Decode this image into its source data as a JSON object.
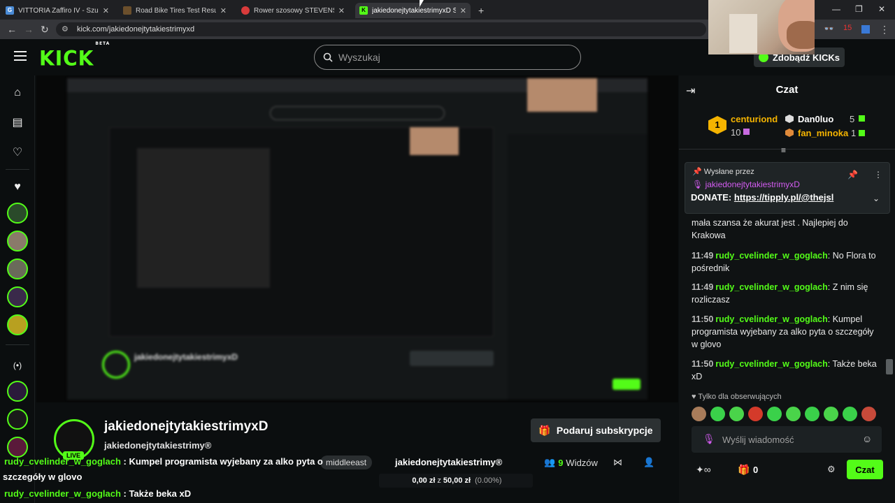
{
  "browser": {
    "tabs": [
      {
        "title": "VITTORIA Zaffiro IV - Szukaj w G",
        "color": "#4a8bd6"
      },
      {
        "title": "Road Bike Tires Test Results | Bi",
        "color": "#6b4f2c"
      },
      {
        "title": "Rower szosowy STEVENS Izoard",
        "color": "#d93b3b"
      },
      {
        "title": "jakiedonejtytakiestrimyxD Stre",
        "color": "#53fc18"
      }
    ],
    "url": "kick.com/jakiedonejtytakiestrimyxd",
    "ext_badge": "15"
  },
  "header": {
    "logo": "KICK",
    "logo_sup": "BETA",
    "search_placeholder": "Wyszukaj",
    "kicks_label": "Zdobądź KICKs"
  },
  "channel": {
    "name": "jakiedonejtytakiestrimyxD",
    "subtitle": "jakiedonejtytakiestrimy®",
    "live": "LIVE",
    "gift_label": "Podaruj subskrypcje",
    "tag": "middleeast",
    "viewers_count": "9",
    "viewers_label": "Widzów",
    "goal_name": "jakiedonejtytakiestrimy®",
    "goal_current": "0,00 zł",
    "goal_sep": "z",
    "goal_target": "50,00 zł",
    "goal_pct": "(0.00%)"
  },
  "overlay": {
    "line1_user": "rudy_cvelinder_w_goglach",
    "line1_text": " : Kumpel programista wyjebany za alko pyta o",
    "line2_text": "szczegóły w glovo",
    "line3_user": "rudy_cvelinder_w_goglach",
    "line3_text": " : Także beka xD"
  },
  "chat": {
    "title": "Czat",
    "leaderboard": [
      {
        "name": "centuriond",
        "value": "10",
        "color": "#f5b400"
      },
      {
        "name": "Dan0luo",
        "value": "5",
        "color": "#ffffff"
      },
      {
        "name": "fan_minoka",
        "value": "1",
        "color": "#f5b400"
      }
    ],
    "pinned": {
      "header": "Wysłane przez",
      "user": "jakiedonejtytakiestrimyxD",
      "prefix": "DONATE: ",
      "link": "https://tipply.pl/@thejsl"
    },
    "messages": [
      {
        "time": "",
        "user": "",
        "text": "mała szansa że akurat jest . Najlepiej do Krakowa"
      },
      {
        "time": "11:49",
        "user": "rudy_cvelinder_w_goglach",
        "text": ": No Flora to pośrednik"
      },
      {
        "time": "11:49",
        "user": "rudy_cvelinder_w_goglach",
        "text": ": Z nim się rozliczasz"
      },
      {
        "time": "11:50",
        "user": "rudy_cvelinder_w_goglach",
        "text": ": Kumpel programista wyjebany za alko pyta o szczegóły w glovo"
      },
      {
        "time": "11:50",
        "user": "rudy_cvelinder_w_goglach",
        "text": ": Także beka xD"
      }
    ],
    "followers_only": "Tylko dla obserwujących",
    "input_placeholder": "Wyślij wiadomość",
    "points": "0",
    "send_label": "Czat"
  },
  "colors": {
    "accent": "#53fc18",
    "bg": "#0b0e0f",
    "chat_bg": "#0f1213"
  }
}
